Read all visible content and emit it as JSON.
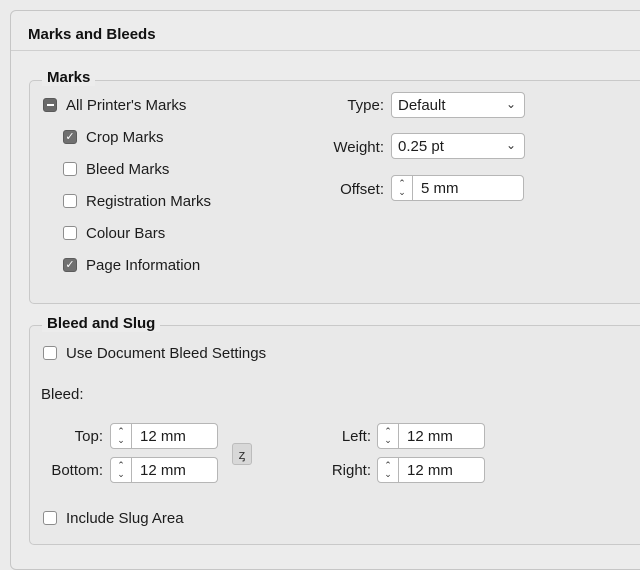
{
  "panel": {
    "title": "Marks and Bleeds"
  },
  "marks": {
    "legend": "Marks",
    "all_printers_marks": {
      "label": "All Printer's Marks",
      "state": "mixed"
    },
    "items": [
      {
        "label": "Crop Marks",
        "checked": true
      },
      {
        "label": "Bleed Marks",
        "checked": false
      },
      {
        "label": "Registration Marks",
        "checked": false
      },
      {
        "label": "Colour Bars",
        "checked": false
      },
      {
        "label": "Page Information",
        "checked": true
      }
    ],
    "type": {
      "label": "Type:",
      "value": "Default"
    },
    "weight": {
      "label": "Weight:",
      "value": "0.25 pt"
    },
    "offset": {
      "label": "Offset:",
      "value": "5 mm"
    }
  },
  "bleed_slug": {
    "legend": "Bleed and Slug",
    "use_document_bleed": {
      "label": "Use Document Bleed Settings",
      "checked": false
    },
    "bleed_label": "Bleed:",
    "top": {
      "label": "Top:",
      "value": "12 mm"
    },
    "bottom": {
      "label": "Bottom:",
      "value": "12 mm"
    },
    "left": {
      "label": "Left:",
      "value": "12 mm"
    },
    "right": {
      "label": "Right:",
      "value": "12 mm"
    },
    "include_slug": {
      "label": "Include Slug Area",
      "checked": false
    }
  },
  "icons": {
    "chevron": "chevron-down-icon",
    "spinner": "stepper-arrows-icon",
    "link": "chain-link-icon",
    "check": "checkmark-icon"
  }
}
